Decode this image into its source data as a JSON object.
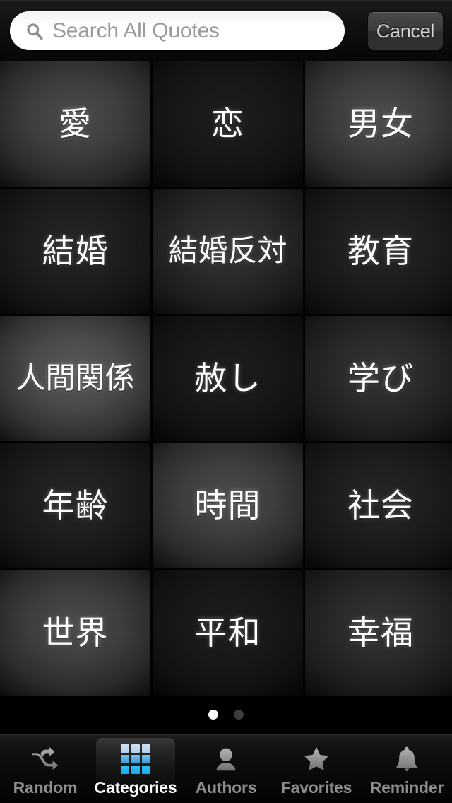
{
  "search": {
    "placeholder": "Search All Quotes",
    "value": "",
    "icon": "search-icon",
    "cancel_label": "Cancel"
  },
  "grid": {
    "columns": 3,
    "rows": 5,
    "tiles": [
      {
        "label": "愛",
        "brightness": "b-mid"
      },
      {
        "label": "恋",
        "brightness": "b-darker"
      },
      {
        "label": "男女",
        "brightness": "b-mid"
      },
      {
        "label": "結婚",
        "brightness": "b-dark"
      },
      {
        "label": "結婚反対",
        "brightness": "b-dim"
      },
      {
        "label": "教育",
        "brightness": "b-dark"
      },
      {
        "label": "人間関係",
        "brightness": "b-bright"
      },
      {
        "label": "赦し",
        "brightness": "b-darker"
      },
      {
        "label": "学び",
        "brightness": "b-dim"
      },
      {
        "label": "年齢",
        "brightness": "b-dark"
      },
      {
        "label": "時間",
        "brightness": "b-mid"
      },
      {
        "label": "社会",
        "brightness": "b-dark"
      },
      {
        "label": "世界",
        "brightness": "b-mid"
      },
      {
        "label": "平和",
        "brightness": "b-darker"
      },
      {
        "label": "幸福",
        "brightness": "b-dim"
      }
    ]
  },
  "pager": {
    "total_pages": 2,
    "current_page": 1
  },
  "tab_bar": {
    "active_index": 1,
    "items": [
      {
        "label": "Random",
        "icon": "shuffle-icon"
      },
      {
        "label": "Categories",
        "icon": "grid-icon"
      },
      {
        "label": "Authors",
        "icon": "person-icon"
      },
      {
        "label": "Favorites",
        "icon": "star-icon"
      },
      {
        "label": "Reminder",
        "icon": "bell-icon"
      }
    ]
  },
  "colors": {
    "accent": "#17a9ec",
    "tab_inactive": "#8d8d8d",
    "tab_active": "#ffffff",
    "background": "#000000",
    "placeholder": "#9b9b9b"
  }
}
